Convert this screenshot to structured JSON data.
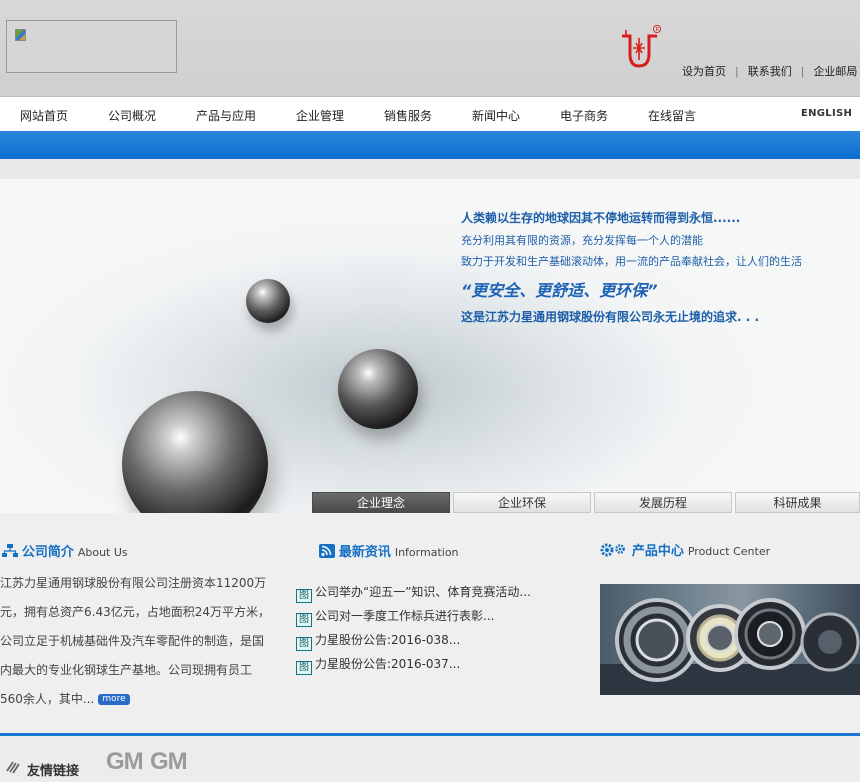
{
  "header": {
    "links": [
      "设为首页",
      "联系我们",
      "企业邮局"
    ]
  },
  "nav": {
    "items": [
      "网站首页",
      "公司概况",
      "产品与应用",
      "企业管理",
      "销售服务",
      "新闻中心",
      "电子商务",
      "在线留言"
    ],
    "english": "ENGLISH"
  },
  "banner": {
    "line1": "人类赖以生存的地球因其不停地运转而得到永恒......",
    "line2": "充分利用其有限的资源，充分发挥每一个人的潜能",
    "line3": "致力于开发和生产基础滚动体，用一流的产品奉献社会，让人们的生活",
    "line4": "“更安全、更舒适、更环保”",
    "line5": "这是江苏力星通用钢球股份有限公司永无止境的追求. . .",
    "tabs": [
      "企业理念",
      "企业环保",
      "发展历程",
      "科研成果"
    ]
  },
  "about": {
    "title": "公司简介",
    "title_en": "About Us",
    "text": "江苏力星通用钢球股份有限公司注册资本11200万元，拥有总资产6.43亿元，占地面积24万平方米，公司立足于机械基础件及汽车零配件的制造，是国内最大的专业化钢球生产基地。公司现拥有员工560余人，其中...",
    "more": "more"
  },
  "news": {
    "title": "最新资讯",
    "title_en": "Information",
    "tag": "图",
    "items": [
      "公司举办“迎五一”知识、体育竞赛活动...",
      "公司对一季度工作标兵进行表彰...",
      "力星股份公告:2016-038...",
      "力星股份公告:2016-037..."
    ]
  },
  "products": {
    "title": "产品中心",
    "title_en": "Product Center"
  },
  "footer": {
    "label": "友情链接",
    "logos": [
      "GM",
      "GM"
    ]
  },
  "colors": {
    "accent_blue": "#1670c4",
    "nav_bar_blue": "#0d6ed0",
    "tab_active": "#4a4a4a"
  }
}
